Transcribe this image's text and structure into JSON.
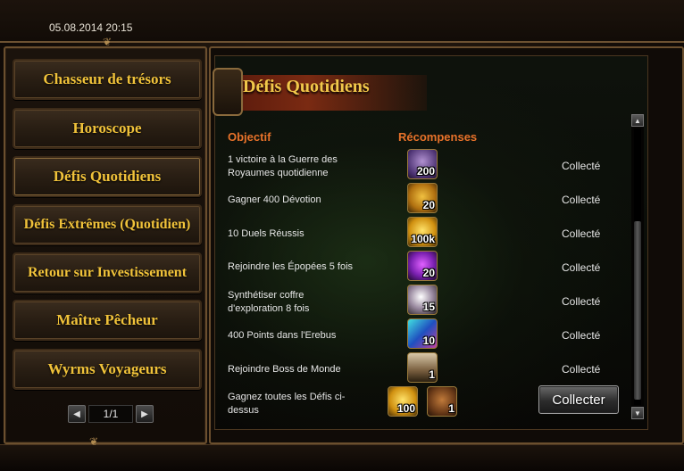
{
  "header": {
    "datetime": "05.08.2014 20:15"
  },
  "menu": {
    "items": [
      {
        "label": "Chasseur de trésors"
      },
      {
        "label": "Horoscope"
      },
      {
        "label": "Défis Quotidiens"
      },
      {
        "label": "Défis Extrêmes (Quotidien)"
      },
      {
        "label": "Retour sur Investissement"
      },
      {
        "label": "Maître Pêcheur"
      },
      {
        "label": "Wyrms Voyageurs"
      }
    ],
    "pager": {
      "text": "1/1",
      "prev_icon": "triangle-left-icon",
      "next_icon": "triangle-right-icon"
    }
  },
  "panel": {
    "title": "Défis Quotidiens",
    "col_objective": "Objectif",
    "col_rewards": "Récompenses",
    "rows": [
      {
        "objective": "1 victoire à la Guerre des Royaumes quotidienne",
        "reward_qty": "200",
        "reward_icon": "trophy-icon",
        "status": "Collecté"
      },
      {
        "objective": "Gagner 400 Dévotion",
        "reward_qty": "20",
        "reward_icon": "coin-icon",
        "status": "Collecté"
      },
      {
        "objective": "10 Duels Réussis",
        "reward_qty": "100k",
        "reward_icon": "gold-coin-icon",
        "status": "Collecté"
      },
      {
        "objective": "Rejoindre les Épopées 5 fois",
        "reward_qty": "20",
        "reward_icon": "purple-orb-icon",
        "status": "Collecté"
      },
      {
        "objective": "Synthétiser coffre d'exploration 8 fois",
        "reward_qty": "15",
        "reward_icon": "pearl-icon",
        "status": "Collecté"
      },
      {
        "objective": "400 Points dans l'Erebus",
        "reward_qty": "10",
        "reward_icon": "gem-icon",
        "status": "Collecté"
      },
      {
        "objective": "Rejoindre Boss de Monde",
        "reward_qty": "1",
        "reward_icon": "chest-icon",
        "status": "Collecté"
      }
    ],
    "final_row": {
      "objective": "Gagnez toutes les Défis ci-dessus",
      "rewards": [
        {
          "qty": "100",
          "icon": "gold-coin-icon"
        },
        {
          "qty": "1",
          "icon": "bronze-coin-icon"
        }
      ],
      "button_label": "Collecter"
    }
  }
}
